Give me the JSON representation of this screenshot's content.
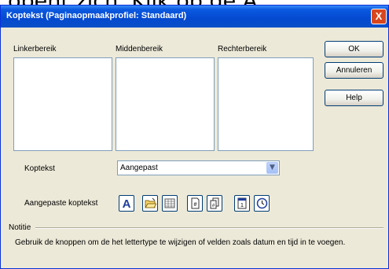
{
  "background_text": "opent zich. Klik op de A",
  "dialog": {
    "title": "Koptekst (Paginaopmaakprofiel: Standaard)",
    "close_label": "X"
  },
  "areas": {
    "left_label": "Linkerbereik",
    "center_label": "Middenbereik",
    "right_label": "Rechterbereik"
  },
  "buttons": {
    "ok": "OK",
    "cancel": "Annuleren",
    "help": "Help"
  },
  "header": {
    "label": "Koptekst",
    "selected": "Aangepast"
  },
  "custom_header": {
    "label": "Aangepaste koptekst",
    "icons": [
      "font-a-icon",
      "folder-icon",
      "table-icon",
      "page-number-icon",
      "page-count-icon",
      "date-icon",
      "clock-icon"
    ]
  },
  "note": {
    "label": "Notitie",
    "text": "Gebruik de knoppen om de het lettertype te wijzigen of velden zoals datum en tijd in te voegen."
  },
  "colors": {
    "titlebar": "#0449d0",
    "dialog_bg": "#ece9d8",
    "close": "#d9461e"
  }
}
